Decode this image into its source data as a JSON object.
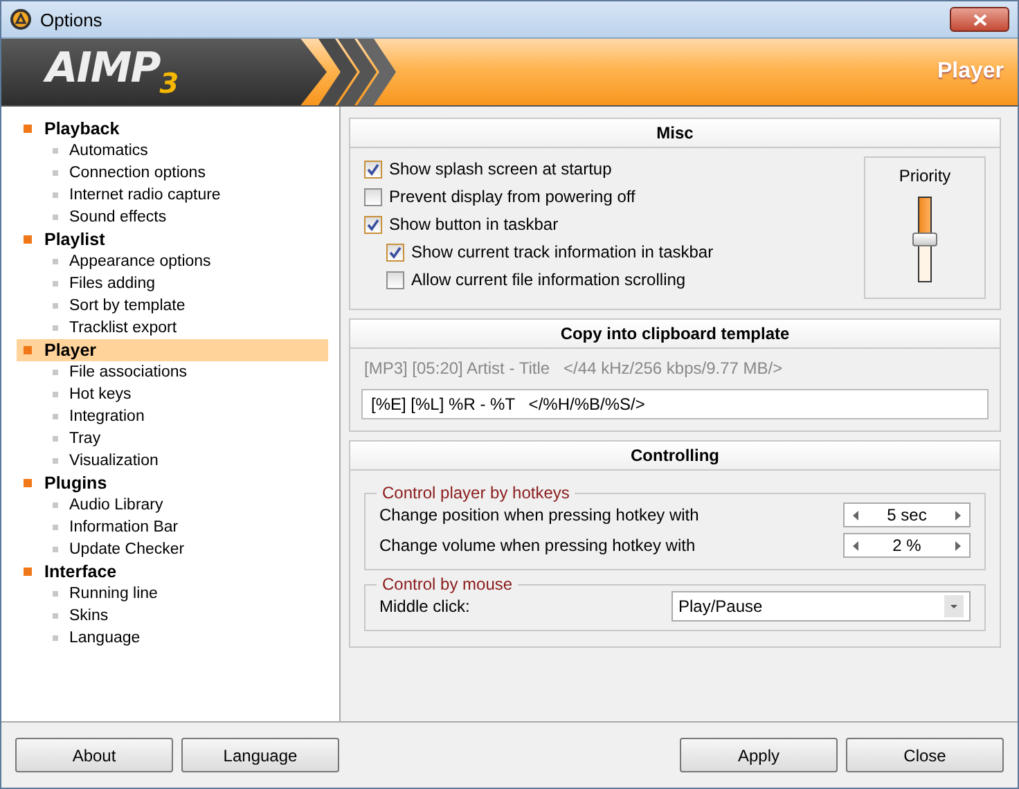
{
  "window": {
    "title": "Options"
  },
  "banner": {
    "logo": "AIMP",
    "logo_version": "3",
    "title": "Player"
  },
  "sidebar": {
    "items": [
      {
        "label": "Playback",
        "selected": false,
        "children": [
          {
            "label": "Automatics",
            "selected": false
          },
          {
            "label": "Connection options",
            "selected": false
          },
          {
            "label": "Internet radio capture",
            "selected": false
          },
          {
            "label": "Sound effects",
            "selected": false
          }
        ]
      },
      {
        "label": "Playlist",
        "selected": false,
        "children": [
          {
            "label": "Appearance options",
            "selected": false
          },
          {
            "label": "Files adding",
            "selected": false
          },
          {
            "label": "Sort by template",
            "selected": false
          },
          {
            "label": "Tracklist export",
            "selected": false
          }
        ]
      },
      {
        "label": "Player",
        "selected": true,
        "children": [
          {
            "label": "File associations",
            "selected": false
          },
          {
            "label": "Hot keys",
            "selected": false
          },
          {
            "label": "Integration",
            "selected": false
          },
          {
            "label": "Tray",
            "selected": false
          },
          {
            "label": "Visualization",
            "selected": false
          }
        ]
      },
      {
        "label": "Plugins",
        "selected": false,
        "children": [
          {
            "label": "Audio Library",
            "selected": false
          },
          {
            "label": "Information Bar",
            "selected": false
          },
          {
            "label": "Update Checker",
            "selected": false
          }
        ]
      },
      {
        "label": "Interface",
        "selected": false,
        "children": [
          {
            "label": "Running line",
            "selected": false
          },
          {
            "label": "Skins",
            "selected": false
          },
          {
            "label": "Language",
            "selected": false
          }
        ]
      }
    ]
  },
  "misc": {
    "title": "Misc",
    "options": [
      {
        "label": "Show splash screen at startup",
        "checked": true,
        "nested": false
      },
      {
        "label": "Prevent display from powering off",
        "checked": false,
        "nested": false
      },
      {
        "label": "Show button in taskbar",
        "checked": true,
        "nested": false
      },
      {
        "label": "Show current track information in taskbar",
        "checked": true,
        "nested": true
      },
      {
        "label": "Allow current file information scrolling",
        "checked": false,
        "nested": true
      }
    ],
    "priority": {
      "label": "Priority",
      "level": 0.5
    }
  },
  "clipboard": {
    "title": "Copy into clipboard template",
    "preview": "[MP3] [05:20] Artist - Title   </44 kHz/256 kbps/9.77 MB/>",
    "template": "[%E] [%L] %R - %T   </%H/%B/%S/>"
  },
  "controlling": {
    "title": "Controlling",
    "hotkeys": {
      "title": "Control player by hotkeys",
      "rows": [
        {
          "label": "Change position when pressing hotkey with",
          "value": "5 sec"
        },
        {
          "label": "Change volume when pressing hotkey with",
          "value": "2 %"
        }
      ]
    },
    "mouse": {
      "title": "Control by mouse",
      "label": "Middle click:",
      "value": "Play/Pause"
    }
  },
  "footer": {
    "left_buttons": [
      "About",
      "Language"
    ],
    "right_buttons": [
      "Apply",
      "Close"
    ]
  }
}
